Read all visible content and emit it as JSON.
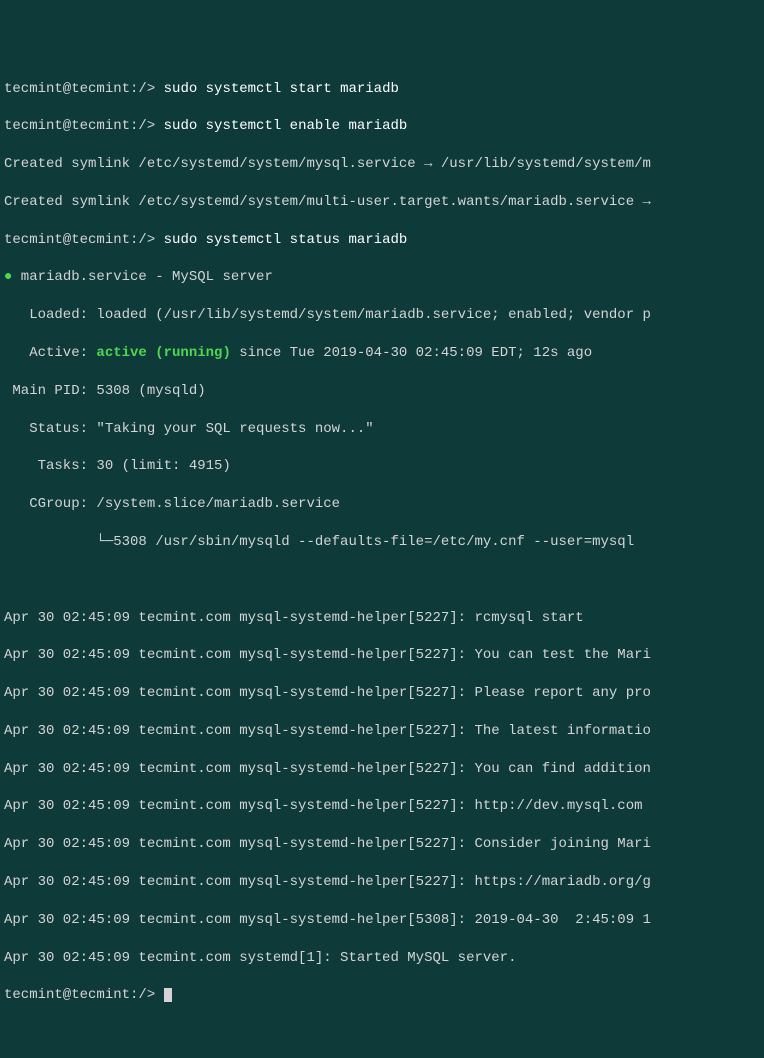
{
  "prompt1": "tecmint@tecmint:/> ",
  "cmd1": "sudo systemctl start mariadb",
  "prompt2": "tecmint@tecmint:/> ",
  "cmd2": "sudo systemctl enable mariadb",
  "symlink1": "Created symlink /etc/systemd/system/mysql.service → /usr/lib/systemd/system/m",
  "symlink2": "Created symlink /etc/systemd/system/multi-user.target.wants/mariadb.service →",
  "prompt3": "tecmint@tecmint:/> ",
  "cmd3": "sudo systemctl status mariadb",
  "status_dot": "●",
  "status_header": " mariadb.service - MySQL server",
  "loaded": "   Loaded: loaded (/usr/lib/systemd/system/mariadb.service; enabled; vendor p",
  "active_label": "   Active: ",
  "active_value": "active (running)",
  "active_since": " since Tue 2019-04-30 02:45:09 EDT; 12s ago",
  "main_pid": " Main PID: 5308 (mysqld)",
  "status_msg": "   Status: \"Taking your SQL requests now...\"",
  "tasks": "    Tasks: 30 (limit: 4915)",
  "cgroup": "   CGroup: /system.slice/mariadb.service",
  "cgroup_child": "           └─5308 /usr/sbin/mysqld --defaults-file=/etc/my.cnf --user=mysql",
  "logs": [
    "Apr 30 02:45:09 tecmint.com mysql-systemd-helper[5227]: rcmysql start",
    "Apr 30 02:45:09 tecmint.com mysql-systemd-helper[5227]: You can test the Mari",
    "Apr 30 02:45:09 tecmint.com mysql-systemd-helper[5227]: Please report any pro",
    "Apr 30 02:45:09 tecmint.com mysql-systemd-helper[5227]: The latest informatio",
    "Apr 30 02:45:09 tecmint.com mysql-systemd-helper[5227]: You can find addition",
    "Apr 30 02:45:09 tecmint.com mysql-systemd-helper[5227]: http://dev.mysql.com",
    "Apr 30 02:45:09 tecmint.com mysql-systemd-helper[5227]: Consider joining Mari",
    "Apr 30 02:45:09 tecmint.com mysql-systemd-helper[5227]: https://mariadb.org/g",
    "Apr 30 02:45:09 tecmint.com mysql-systemd-helper[5308]: 2019-04-30  2:45:09 1",
    "Apr 30 02:45:09 tecmint.com systemd[1]: Started MySQL server."
  ],
  "prompt4": "tecmint@tecmint:/> "
}
